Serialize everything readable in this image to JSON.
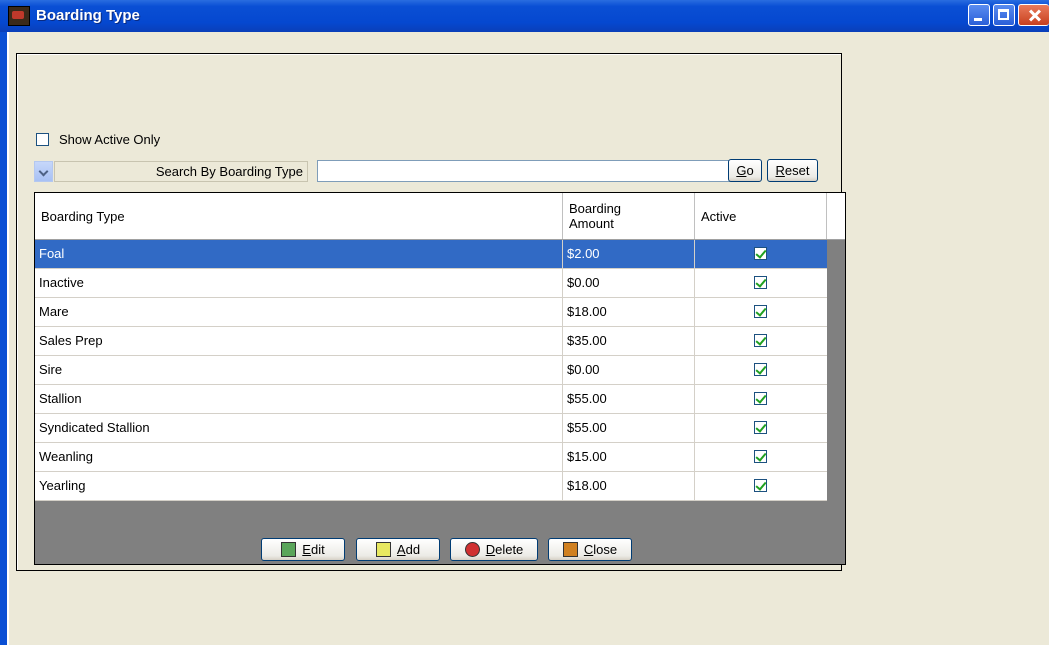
{
  "window": {
    "title": "Boarding Type"
  },
  "filter": {
    "show_active_label": "Show Active Only",
    "search_by_label": "Search By Boarding Type",
    "search_value": ""
  },
  "buttons": {
    "go": {
      "prefix": "",
      "accel": "G",
      "rest": "o"
    },
    "reset": {
      "prefix": "",
      "accel": "R",
      "rest": "eset"
    },
    "edit": {
      "accel": "E",
      "rest": "dit"
    },
    "add": {
      "accel": "A",
      "rest": "dd"
    },
    "delete": {
      "accel": "D",
      "rest": "elete"
    },
    "close": {
      "accel": "C",
      "rest": "lose"
    }
  },
  "grid": {
    "columns": [
      "Boarding Type",
      "Boarding Amount",
      "Active"
    ],
    "column_header_lines": {
      "amount_line1": "Boarding",
      "amount_line2": "Amount"
    },
    "rows": [
      {
        "type": "Foal",
        "amount": "$2.00",
        "active": true,
        "selected": true
      },
      {
        "type": "Inactive",
        "amount": "$0.00",
        "active": true
      },
      {
        "type": "Mare",
        "amount": "$18.00",
        "active": true
      },
      {
        "type": "Sales Prep",
        "amount": "$35.00",
        "active": true
      },
      {
        "type": "Sire",
        "amount": "$0.00",
        "active": true
      },
      {
        "type": "Stallion",
        "amount": "$55.00",
        "active": true
      },
      {
        "type": "Syndicated Stallion",
        "amount": "$55.00",
        "active": true
      },
      {
        "type": "Weanling",
        "amount": "$15.00",
        "active": true
      },
      {
        "type": "Yearling",
        "amount": "$18.00",
        "active": true
      }
    ]
  },
  "colors": {
    "titlebar": "#0a4fd4",
    "selection": "#316ac5",
    "face": "#ece9d8",
    "check": "#21a121"
  },
  "icons": {
    "edit": "edit-icon",
    "add": "add-icon",
    "delete": "delete-icon",
    "close": "close-icon"
  }
}
